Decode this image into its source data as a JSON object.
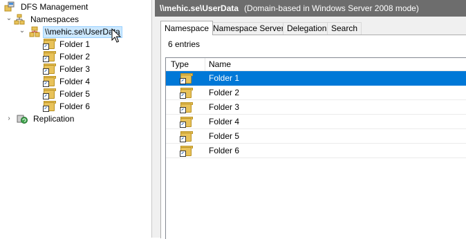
{
  "tree": {
    "root": "DFS Management",
    "namespaces": "Namespaces",
    "namespace_item": "\\\\mehic.se\\UserData",
    "folders": [
      "Folder 1",
      "Folder 2",
      "Folder 3",
      "Folder 4",
      "Folder 5",
      "Folder 6"
    ],
    "replication": "Replication"
  },
  "header": {
    "title": "\\\\mehic.se\\UserData",
    "subtitle": "(Domain-based in Windows Server 2008 mode)"
  },
  "tabs": [
    "Namespace",
    "Namespace Servers",
    "Delegation",
    "Search"
  ],
  "entries_label": "6 entries",
  "list": {
    "columns": [
      "Type",
      "Name"
    ],
    "rows": [
      "Folder 1",
      "Folder 2",
      "Folder 3",
      "Folder 4",
      "Folder 5",
      "Folder 6"
    ],
    "selected_index": 0
  },
  "colors": {
    "selection": "#0078d7",
    "titlebar": "#6d6d6d",
    "tree_selection": "#cce8ff"
  }
}
